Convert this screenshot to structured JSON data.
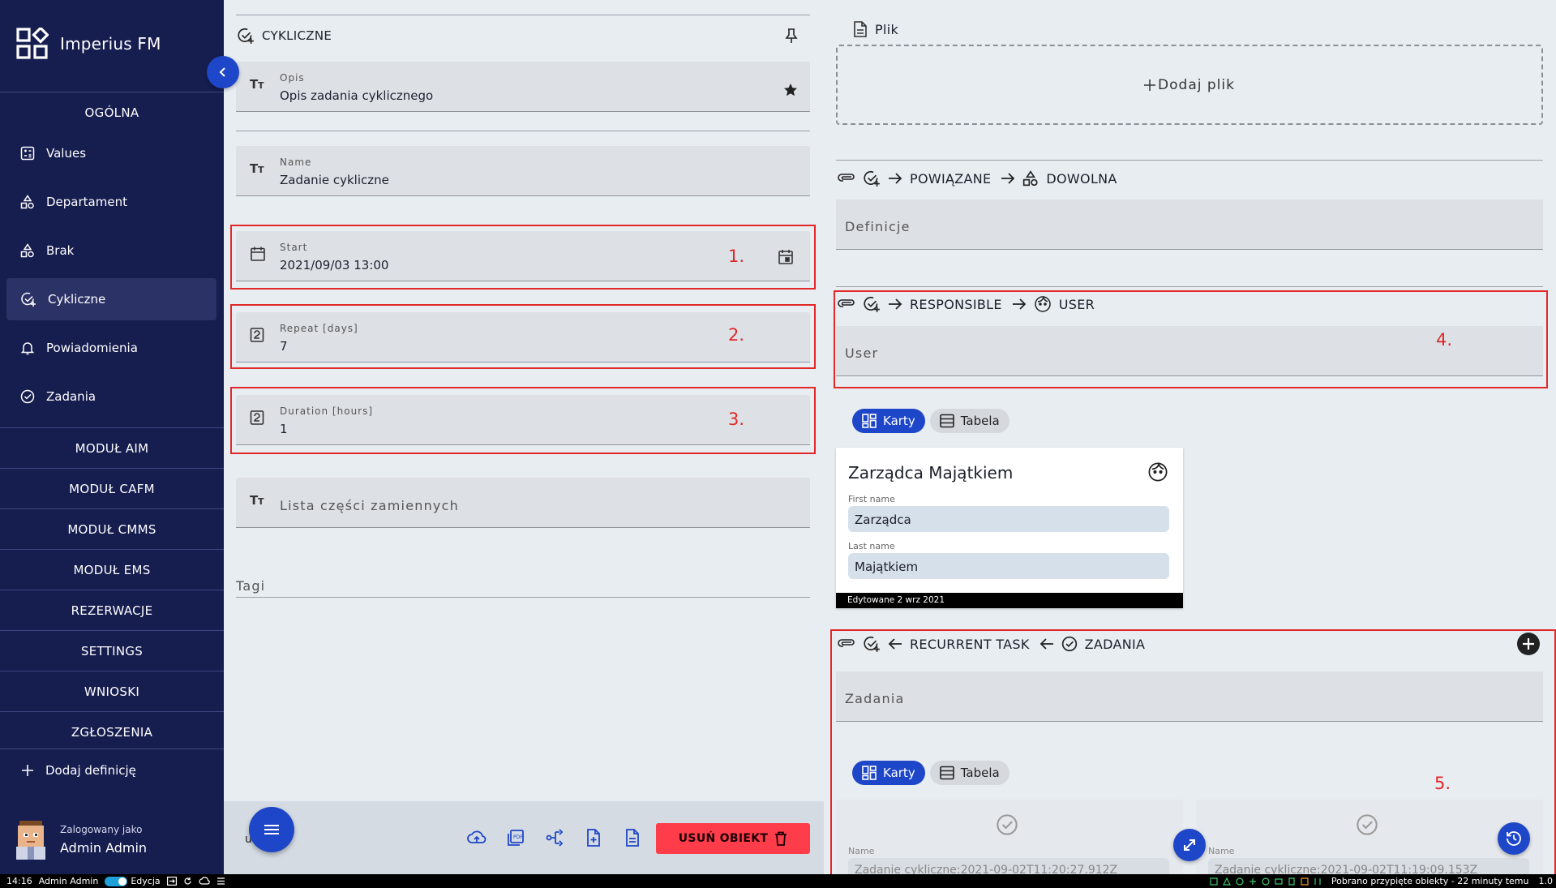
{
  "app": {
    "title": "Imperius FM"
  },
  "sidebar": {
    "sections": {
      "ogolna": "OGÓLNA",
      "aim": "MODUŁ AIM",
      "cafm": "MODUŁ CAFM",
      "cmms": "MODUŁ CMMS",
      "ems": "MODUŁ EMS",
      "rezerwacje": "REZERWACJE",
      "settings": "SETTINGS",
      "wnioski": "WNIOSKI",
      "zgloszenia": "ZGŁOSZENIA"
    },
    "items": [
      {
        "label": "Values",
        "icon": "calculator-icon"
      },
      {
        "label": "Departament",
        "icon": "shapes-icon"
      },
      {
        "label": "Brak",
        "icon": "shapes-icon"
      },
      {
        "label": "Cykliczne",
        "icon": "check-plus-icon",
        "active": true
      },
      {
        "label": "Powiadomienia",
        "icon": "bell-icon"
      },
      {
        "label": "Zadania",
        "icon": "check-circle-icon"
      }
    ],
    "add_definition": "Dodaj definicję",
    "user": {
      "logged_as": "Zalogowany jako",
      "name": "Admin Admin"
    }
  },
  "middle": {
    "header": "CYKLICZNE",
    "fields": {
      "opis": {
        "label": "Opis",
        "value": "Opis zadania cyklicznego"
      },
      "name": {
        "label": "Name",
        "value": "Zadanie cykliczne"
      },
      "start": {
        "label": "Start",
        "value": "2021/09/03 13:00"
      },
      "repeat": {
        "label": "Repeat [days]",
        "value": "7"
      },
      "duration": {
        "label": "Duration [hours]",
        "value": "1"
      },
      "parts": {
        "placeholder": "Lista części zamiennych"
      }
    },
    "tags_placeholder": "Tagi",
    "toolbar": {
      "delete_label": "USUŃ OBIEKT",
      "partial_text": "u"
    }
  },
  "annotations": {
    "a1": "1.",
    "a2": "2.",
    "a3": "3.",
    "a4": "4.",
    "a5": "5."
  },
  "right": {
    "file": {
      "label": "Plik",
      "add": "Dodaj plik"
    },
    "rel1": {
      "p1": "POWIĄZANE",
      "p2": "DOWOLNA",
      "placeholder": "Definicje"
    },
    "rel2": {
      "p1": "RESPONSIBLE",
      "p2": "USER",
      "placeholder": "User"
    },
    "view_toggle": {
      "cards": "Karty",
      "table": "Tabela"
    },
    "user_card": {
      "title": "Zarządca Majątkiem",
      "first_name_label": "First name",
      "first_name": "Zarządca",
      "last_name_label": "Last name",
      "last_name": "Majątkiem",
      "footer": "Edytowane 2 wrz 2021"
    },
    "rel3": {
      "p1": "RECURRENT TASK",
      "p2": "ZADANIA",
      "placeholder": "Zadania"
    },
    "task_cards": [
      {
        "name_label": "Name",
        "name": "Zadanie cykliczne:2021-09-02T11:20:27.912Z"
      },
      {
        "name_label": "Name",
        "name": "Zadanie cykliczne:2021-09-02T11:19:09.153Z"
      }
    ]
  },
  "status_bar": {
    "time": "14:16",
    "user": "Admin Admin",
    "edit_label": "Edycja",
    "message": "Pobrano przypięte obiekty - 22 minuty temu",
    "version": "1.0"
  },
  "colors": {
    "sidebar_bg": "#161d4f",
    "accent": "#1e46c8",
    "danger": "#ff3d4a",
    "annotation": "#e22828"
  }
}
